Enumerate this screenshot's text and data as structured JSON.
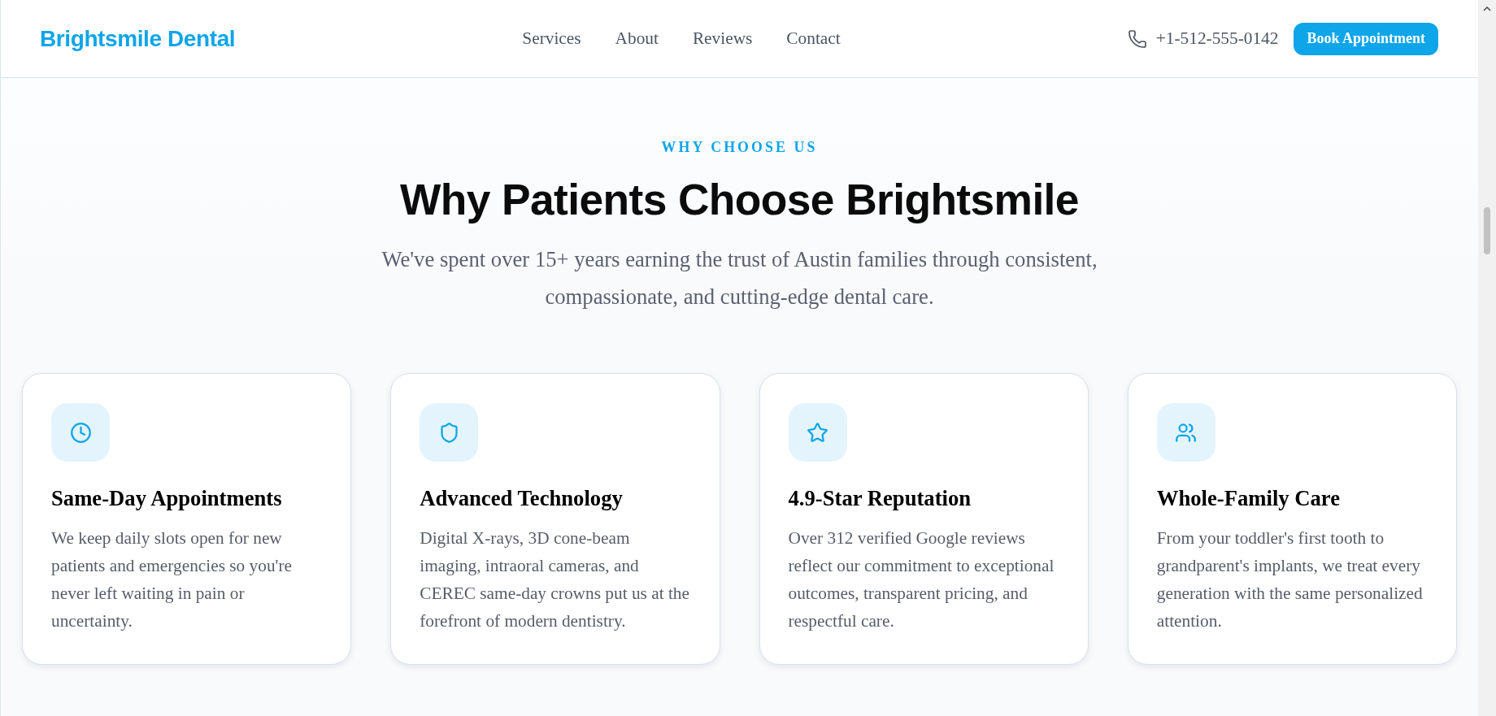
{
  "header": {
    "logo": "Brightsmile Dental",
    "nav": [
      "Services",
      "About",
      "Reviews",
      "Contact"
    ],
    "phone": "+1-512-555-0142",
    "cta": "Book Appointment"
  },
  "section": {
    "eyebrow": "WHY CHOOSE US",
    "title": "Why Patients Choose Brightsmile",
    "subtitle": "We've spent over 15+ years earning the trust of Austin families through consistent, compassionate, and cutting-edge dental care.",
    "features": [
      {
        "title": "Same-Day Appointments",
        "description": "We keep daily slots open for new patients and emergencies so you're never left waiting in pain or uncertainty."
      },
      {
        "title": "Advanced Technology",
        "description": "Digital X-rays, 3D cone-beam imaging, intraoral cameras, and CEREC same-day crowns put us at the forefront of modern dentistry."
      },
      {
        "title": "4.9-Star Reputation",
        "description": "Over 312 verified Google reviews reflect our commitment to exceptional outcomes, transparent pricing, and respectful care."
      },
      {
        "title": "Whole-Family Care",
        "description": "From your toddler's first tooth to grandparent's implants, we treat every generation with the same personalized attention."
      }
    ]
  }
}
